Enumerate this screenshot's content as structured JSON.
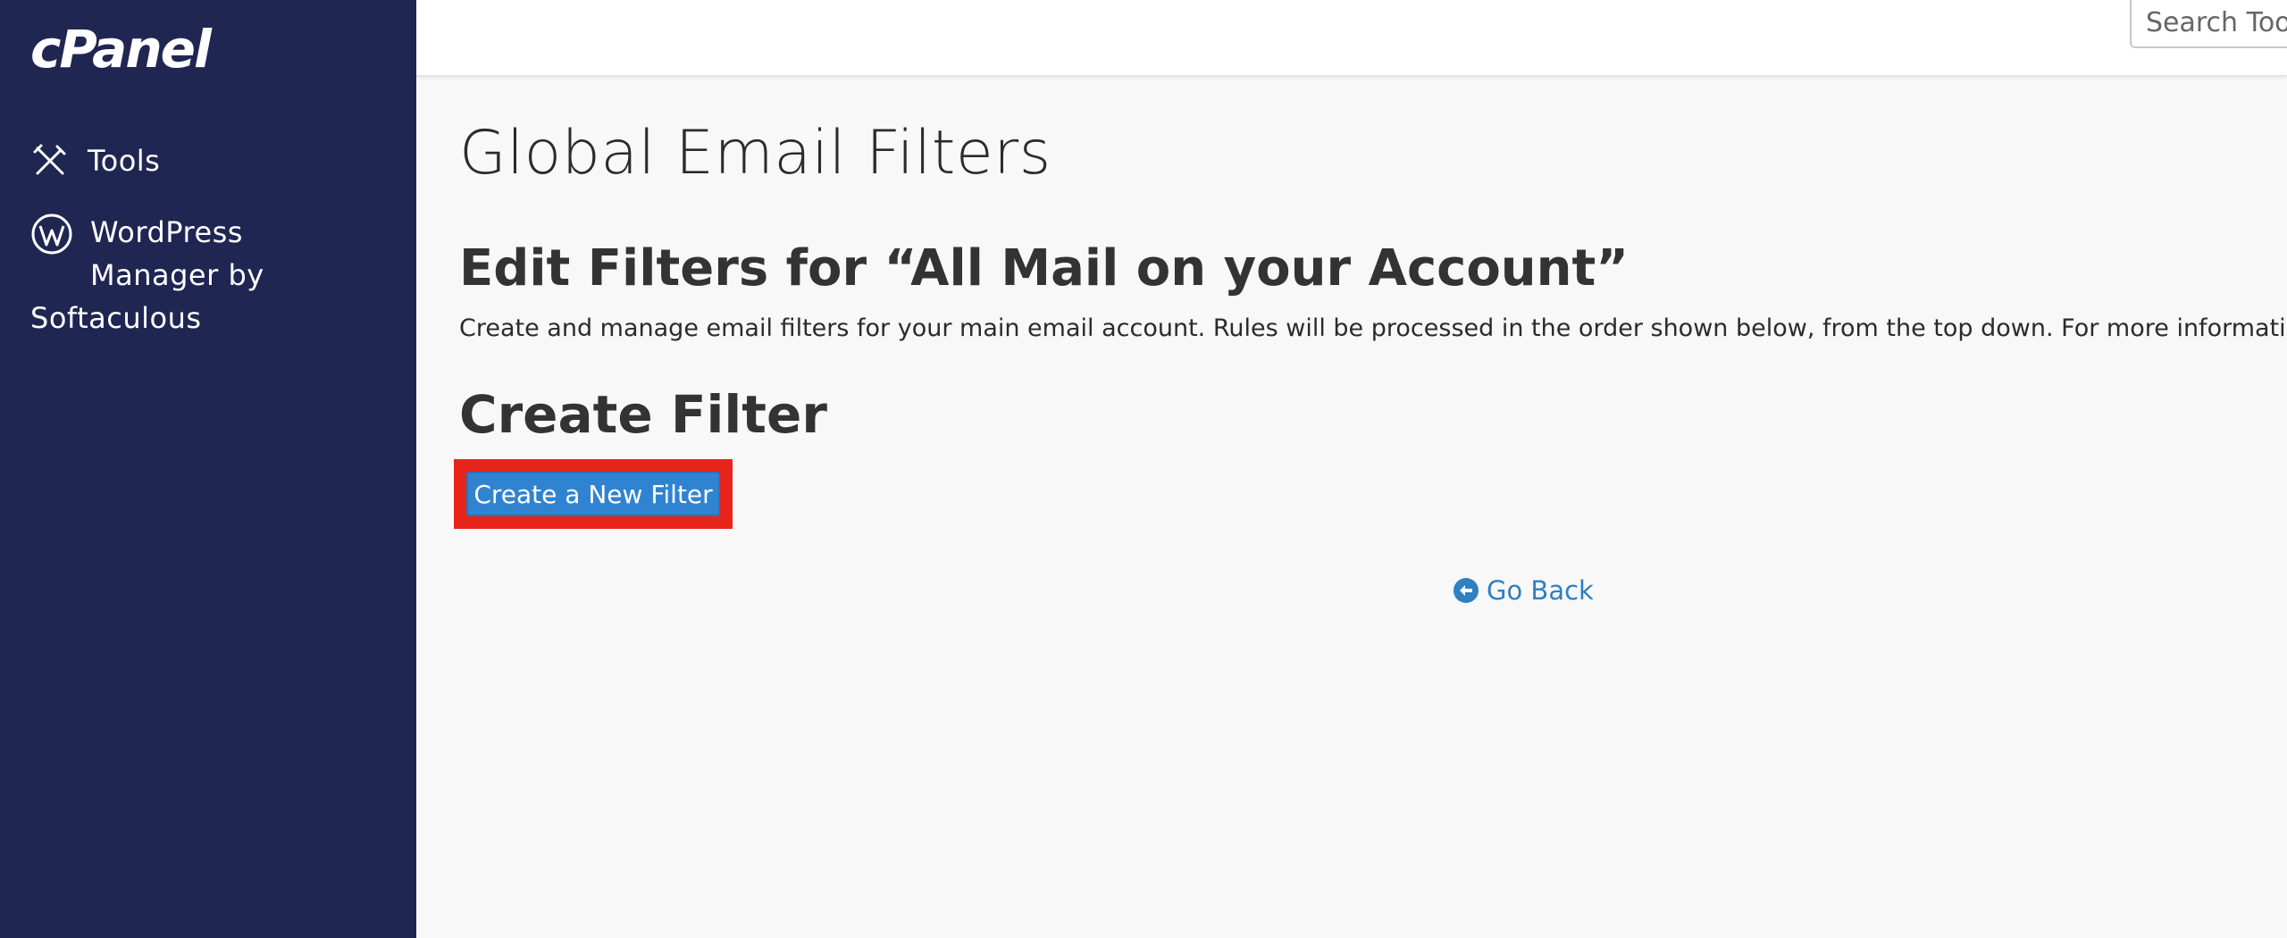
{
  "sidebar": {
    "logo": "cPanel",
    "items": [
      {
        "label": "Tools",
        "icon": "tools-icon"
      },
      {
        "label_lines": [
          "WordPress",
          "Manager by",
          "Softaculous"
        ],
        "icon": "wordpress-icon"
      }
    ],
    "background": "#202652"
  },
  "header": {
    "search_placeholder": "Search Tools (/)"
  },
  "main": {
    "page_title": "Global Email Filters",
    "section_title": "Edit Filters for “All Mail on your Account”",
    "description": "Create and manage email filters for your main email account. Rules will be processed in the order shown below, from the top down. For more information, rea",
    "create_heading": "Create Filter",
    "create_button_label": "Create a New Filter",
    "go_back_label": "Go Back",
    "highlight_color": "#e8241a",
    "accent_color": "#3083d1"
  }
}
